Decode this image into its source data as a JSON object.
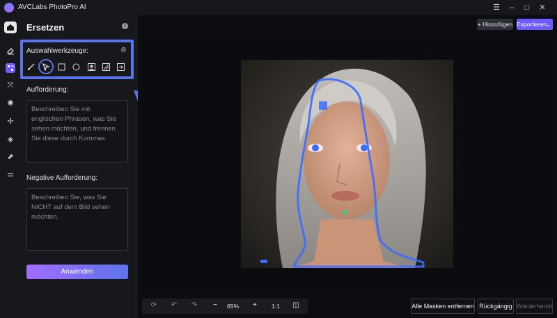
{
  "window": {
    "title": "AVCLabs PhotoPro AI"
  },
  "panel": {
    "title": "Ersetzen",
    "tools_label": "Auswahlwerkzeuge:",
    "prompt_label": "Aufforderung:",
    "prompt_placeholder": "Beschreiben Sie mit englischen Phrasen, was Sie sehen möchten, und trennen Sie diese durch Kommas.",
    "negative_label": "Negative Aufforderung:",
    "negative_placeholder": "Beschreiben Sie, was Sie NICHT auf dem Bild sehen möchten.",
    "apply_label": "Anwenden"
  },
  "header": {
    "add_label": "+ Hinzufügen",
    "export_label": "Exportieren"
  },
  "zoombar": {
    "zoom": "65%",
    "ratio": "1:1"
  },
  "bottom": {
    "remove_masks": "Alle Masken entfernen",
    "undo": "Rückgängig",
    "restore": "Wiederherstellen"
  },
  "colors": {
    "accent": "#5d73ec",
    "mask": "#3d6bff",
    "brand": "#6d5bff"
  }
}
